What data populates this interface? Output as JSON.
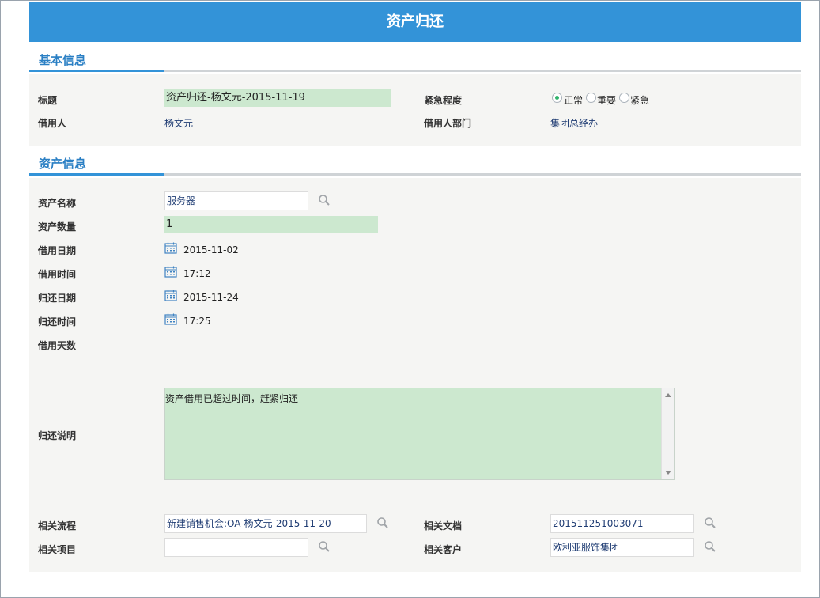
{
  "header": {
    "title": "资产归还"
  },
  "sections": {
    "basic": {
      "title": "基本信息"
    },
    "asset": {
      "title": "资产信息"
    }
  },
  "basic": {
    "title_label": "标题",
    "title_value": "资产归还-杨文元-2015-11-19",
    "urgency_label": "紧急程度",
    "urgency_options": [
      "正常",
      "重要",
      "紧急"
    ],
    "urgency_selected": "正常",
    "borrower_label": "借用人",
    "borrower_value": "杨文元",
    "dept_label": "借用人部门",
    "dept_value": "集团总经办"
  },
  "asset": {
    "name_label": "资产名称",
    "name_value": "服务器",
    "qty_label": "资产数量",
    "qty_value": "1",
    "borrow_date_label": "借用日期",
    "borrow_date_value": "2015-11-02",
    "borrow_time_label": "借用时间",
    "borrow_time_value": "17:12",
    "return_date_label": "归还日期",
    "return_date_value": "2015-11-24",
    "return_time_label": "归还时间",
    "return_time_value": "17:25",
    "days_label": "借用天数",
    "note_label": "归还说明",
    "note_value": "资产借用已超过时间，赶紧归还",
    "flow_label": "相关流程",
    "flow_value": "新建销售机会:OA-杨文元-2015-11-20",
    "doc_label": "相关文档",
    "doc_value": "201511251003071",
    "project_label": "相关项目",
    "project_value": "",
    "customer_label": "相关客户",
    "customer_value": "欧利亚服饰集团"
  },
  "icons": {
    "search": "search-icon",
    "calendar": "calendar-icon"
  },
  "colors": {
    "accent": "#3393d8",
    "field_green": "#cce8cf",
    "panel": "#f5f5f3"
  }
}
